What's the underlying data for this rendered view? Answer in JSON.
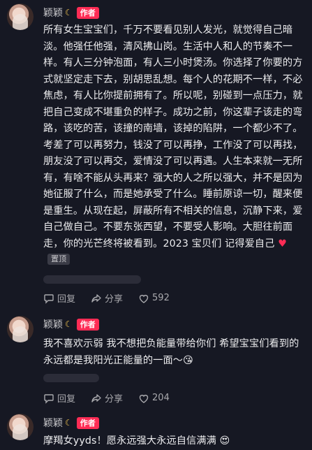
{
  "comments": [
    {
      "username": "颖颖",
      "author_badge": "作者",
      "text": "所有女生宝宝们，千万不要看见别人发光，就觉得自己暗淡。他强任他强，清风拂山岗。生活中人和人的节奏不一样。有人三分钟泡面，有人三小时煲汤。你选择了你要的方式就坚定走下去，别胡思乱想。每个人的花期不一样，不必焦虑，有人比你提前拥有了。所以呢，别碰到一点压力，就把自己变成不堪重负的样子。成功之前，你这辈子该走的弯路，该吃的苦，该撞的南墙，该掉的陷阱，一个都少不了。考差了可以再努力，钱没了可以再挣，工作没了可以再找，朋友没了可以再交，爱情没了可以再遇。人生本来就一无所有，有啥不能从头再来？强大的人之所以强大，并不是因为她征服了什么，而是她承受了什么。睡前原谅一切，醒来便是重生。从现在起，屏蔽所有不相关的信息，沉静下来，爱自己做自己。不要东张西望，不要受人影响。大胆往前面走，你的光芒终将被看到。2023 宝贝们 记得爱自己",
      "heart": "♥",
      "pinned": "置顶",
      "reply": "回复",
      "share": "分享",
      "likes": "592"
    },
    {
      "username": "颖颖",
      "author_badge": "作者",
      "text": "我不喜欢示弱 我不想把负能量带给你们 希望宝宝们看到的永远都是我阳光正能量的一面～",
      "emoji": "😘",
      "reply": "回复",
      "share": "分享",
      "likes": "204"
    },
    {
      "username": "颖颖",
      "author_badge": "作者",
      "text": "摩羯女yyds！愿永远强大永远自信满满",
      "emoji": "😍"
    }
  ],
  "icons": {
    "moon": "crescent-moon-icon",
    "reply": "chat-bubble-icon",
    "share": "share-arrow-icon",
    "like": "heart-outline-icon"
  },
  "colors": {
    "background": "#161823",
    "author_badge": "#fe2c55",
    "heart": "#fe2c55"
  }
}
